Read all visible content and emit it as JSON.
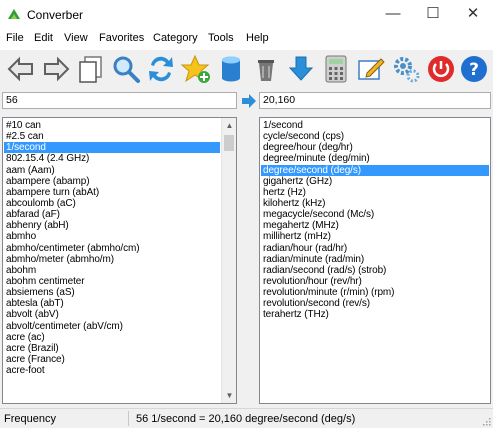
{
  "window": {
    "title": "Converber",
    "minimize": "—",
    "maximize": "☐",
    "close": "✕"
  },
  "menu": [
    "File",
    "Edit",
    "View",
    "Favorites",
    "Category",
    "Tools",
    "Help"
  ],
  "toolbar": {
    "icons": [
      "back-arrow-icon",
      "forward-arrow-icon",
      "copy-icon",
      "search-icon",
      "swap-icon",
      "favorite-star-icon",
      "database-icon",
      "trash-icon",
      "download-icon",
      "calculator-icon",
      "edit-icon",
      "settings-gear-icon",
      "power-icon",
      "help-icon"
    ]
  },
  "from_value": "56",
  "to_value": "20,160",
  "from_units": [
    "#10 can",
    "#2.5 can",
    "1/second",
    "802.15.4 (2.4 GHz)",
    "aam (Aam)",
    "abampere (abamp)",
    "abampere turn (abAt)",
    "abcoulomb (aC)",
    "abfarad (aF)",
    "abhenry (abH)",
    "abmho",
    "abmho/centimeter (abmho/cm)",
    "abmho/meter (abmho/m)",
    "abohm",
    "abohm centimeter",
    "absiemens (aS)",
    "abtesla (abT)",
    "abvolt (abV)",
    "abvolt/centimeter (abV/cm)",
    "acre (ac)",
    "acre (Brazil)",
    "acre (France)",
    "acre-foot"
  ],
  "from_selected": "1/second",
  "to_units": [
    "1/second",
    "cycle/second (cps)",
    "degree/hour (deg/hr)",
    "degree/minute (deg/min)",
    "degree/second (deg/s)",
    "gigahertz (GHz)",
    "hertz (Hz)",
    "kilohertz (kHz)",
    "megacycle/second (Mc/s)",
    "megahertz (MHz)",
    "millihertz (mHz)",
    "radian/hour (rad/hr)",
    "radian/minute (rad/min)",
    "radian/second (rad/s) (strob)",
    "revolution/hour (rev/hr)",
    "revolution/minute (r/min) (rpm)",
    "revolution/second (rev/s)",
    "terahertz (THz)"
  ],
  "to_selected": "degree/second (deg/s)",
  "status": {
    "category": "Frequency",
    "result": "56 1/second = 20,160 degree/second (deg/s)"
  },
  "colors": {
    "selection": "#3399ff",
    "window_bg": "#f0f0f0"
  }
}
